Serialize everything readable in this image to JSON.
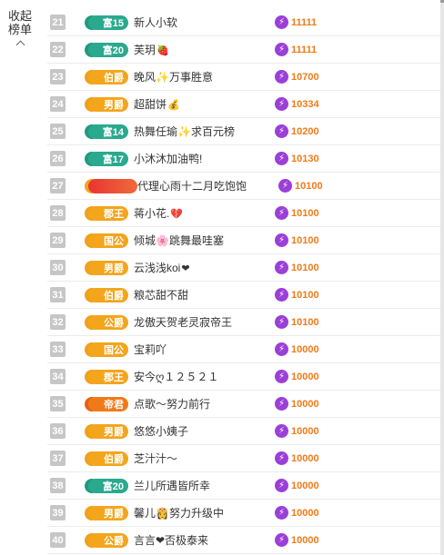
{
  "collapse_label": "收起榜单",
  "rows": [
    {
      "rank": "21",
      "badge": "富15",
      "tier": "fu",
      "name": "新人小软",
      "emoji": "",
      "score": "11111"
    },
    {
      "rank": "22",
      "badge": "富20",
      "tier": "fu",
      "name": "芙玥",
      "emoji": "🍓",
      "score": "11111"
    },
    {
      "rank": "23",
      "badge": "伯爵",
      "tier": "gold",
      "name": "晚风✨万事胜意",
      "emoji": "",
      "score": "10700"
    },
    {
      "rank": "24",
      "badge": "男爵",
      "tier": "gold",
      "name": "超甜饼",
      "emoji": "💰",
      "score": "10334"
    },
    {
      "rank": "25",
      "badge": "富14",
      "tier": "fu",
      "name": "热舞任瑜✨求百元榜",
      "emoji": "",
      "score": "10200"
    },
    {
      "rank": "26",
      "badge": "富17",
      "tier": "fu",
      "name": "小沐沐加油鸭!",
      "emoji": "",
      "score": "10130"
    },
    {
      "rank": "27",
      "badge": "",
      "tier": "red",
      "name": "代理心雨十二月吃饱饱",
      "emoji": "",
      "score": "10100"
    },
    {
      "rank": "28",
      "badge": "郡王",
      "tier": "gold",
      "name": "蒋小花.",
      "emoji": "💔",
      "score": "10100"
    },
    {
      "rank": "29",
      "badge": "国公",
      "tier": "gold",
      "name": "倾城🌸跳舞最哇塞",
      "emoji": "",
      "score": "10100"
    },
    {
      "rank": "30",
      "badge": "男爵",
      "tier": "gold",
      "name": "云浅浅koi",
      "emoji": "❤",
      "score": "10100"
    },
    {
      "rank": "31",
      "badge": "伯爵",
      "tier": "gold",
      "name": "粮芯甜不甜",
      "emoji": "",
      "score": "10100"
    },
    {
      "rank": "32",
      "badge": "公爵",
      "tier": "gold",
      "name": "龙傲天贺老灵寂帝王",
      "emoji": "",
      "score": "10100"
    },
    {
      "rank": "33",
      "badge": "国公",
      "tier": "gold",
      "name": "宝莉吖",
      "emoji": "",
      "score": "10000"
    },
    {
      "rank": "34",
      "badge": "郡王",
      "tier": "gold",
      "name": "安今ღ１２５２１",
      "emoji": "",
      "score": "10000"
    },
    {
      "rank": "35",
      "badge": "帝君",
      "tier": "emp",
      "name": "点歌～努力前行",
      "emoji": "",
      "score": "10000"
    },
    {
      "rank": "36",
      "badge": "男爵",
      "tier": "gold",
      "name": "悠悠小姨子",
      "emoji": "",
      "score": "10000"
    },
    {
      "rank": "37",
      "badge": "伯爵",
      "tier": "gold",
      "name": "芝汁汁～",
      "emoji": "",
      "score": "10000"
    },
    {
      "rank": "38",
      "badge": "富20",
      "tier": "fu",
      "name": "兰儿所遇皆所幸",
      "emoji": "",
      "score": "10000"
    },
    {
      "rank": "39",
      "badge": "男爵",
      "tier": "gold",
      "name": "馨儿👸努力升级中",
      "emoji": "",
      "score": "10000"
    },
    {
      "rank": "40",
      "badge": "公爵",
      "tier": "gold",
      "name": "言言❤否极泰来",
      "emoji": "",
      "score": "10000"
    }
  ]
}
